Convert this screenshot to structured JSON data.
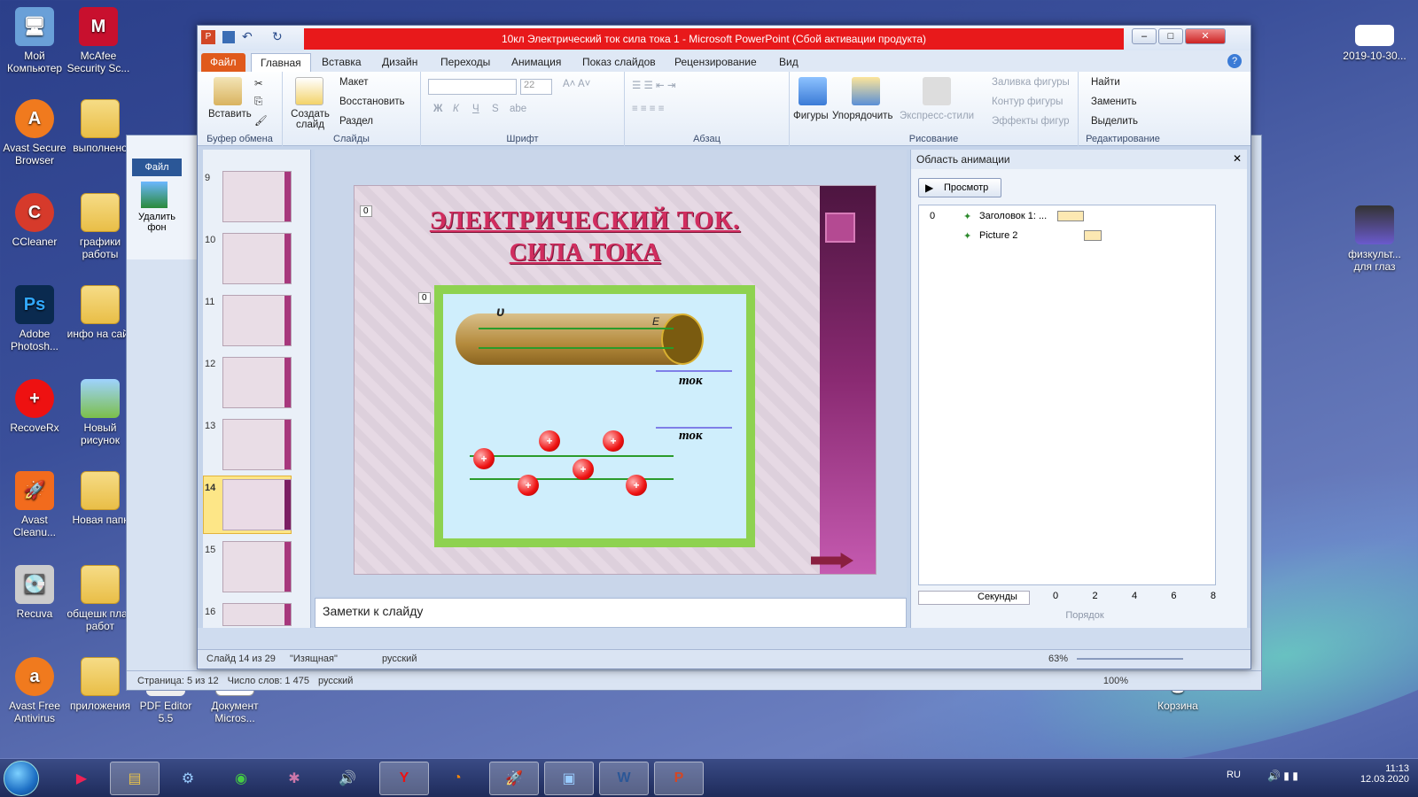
{
  "desktop": {
    "icons": [
      {
        "label": "Мой Компьютер"
      },
      {
        "label": "McAfee Security Sc..."
      },
      {
        "label": "Avast Secure Browser"
      },
      {
        "label": "выполнено"
      },
      {
        "label": "CCleaner"
      },
      {
        "label": "графики работы"
      },
      {
        "label": "Adobe Photosh..."
      },
      {
        "label": "инфо на сайт"
      },
      {
        "label": "RecoveRx"
      },
      {
        "label": "Новый рисунок"
      },
      {
        "label": "Avast Cleanu..."
      },
      {
        "label": "Новая папк"
      },
      {
        "label": "Recuva"
      },
      {
        "label": "общешк план работ"
      },
      {
        "label": "Avast Free Antivirus"
      },
      {
        "label": "приложения"
      },
      {
        "label": "PDF Editor 5.5"
      },
      {
        "label": "Документ Micros..."
      },
      {
        "label": "2019-10-30..."
      },
      {
        "label": "физкульт... для глаз"
      },
      {
        "label": "Корзина"
      }
    ]
  },
  "word": {
    "file_tab": "Файл",
    "remove_bg": "Удалить фон",
    "status": {
      "page": "Страница: 5 из 12",
      "words": "Число слов: 1 475",
      "lang": "русский",
      "zoom": "100%"
    }
  },
  "ppt": {
    "title": "10кл Электрический ток сила тока 1  -  Microsoft PowerPoint (Сбой активации продукта)",
    "tabs": [
      "Файл",
      "Главная",
      "Вставка",
      "Дизайн",
      "Переходы",
      "Анимация",
      "Показ слайдов",
      "Рецензирование",
      "Вид"
    ],
    "ribbon": {
      "clipboard": {
        "paste": "Вставить",
        "label": "Буфер обмена"
      },
      "slides": {
        "new_slide": "Создать слайд",
        "layout": "Макет",
        "reset": "Восстановить",
        "section": "Раздел",
        "label": "Слайды"
      },
      "font": {
        "size": "22",
        "label": "Шрифт",
        "bold": "Ж",
        "italic": "К",
        "underline": "Ч",
        "strike": "S",
        "shadow": "abe"
      },
      "paragraph": {
        "label": "Абзац"
      },
      "drawing": {
        "shapes": "Фигуры",
        "arrange": "Упорядочить",
        "quick_styles": "Экспресс-стили",
        "fill": "Заливка фигуры",
        "outline": "Контур фигуры",
        "effects": "Эффекты фигур",
        "label": "Рисование"
      },
      "editing": {
        "find": "Найти",
        "replace": "Заменить",
        "select": "Выделить",
        "label": "Редактирование"
      }
    },
    "slide_panel": {
      "thumbs": [
        {
          "num": "9"
        },
        {
          "num": "10"
        },
        {
          "num": "11"
        },
        {
          "num": "12"
        },
        {
          "num": "13"
        },
        {
          "num": "14"
        },
        {
          "num": "15"
        },
        {
          "num": "16"
        }
      ],
      "selected": "14"
    },
    "slide": {
      "title_line1": "ЭЛЕКТРИЧЕСКИЙ ТОК.",
      "title_line2": "СИЛА ТОКА",
      "anim_tag1": "0",
      "anim_tag2": "0",
      "label_tok1": "ток",
      "label_tok2": "ток",
      "label_v": "υ",
      "label_E": "E"
    },
    "notes_placeholder": "Заметки к слайду",
    "animation_pane": {
      "title": "Область анимации",
      "play": "Просмотр",
      "items": [
        {
          "index": "0",
          "name": "Заголовок 1: ..."
        },
        {
          "index": "",
          "name": "Picture 2"
        }
      ],
      "seconds": "Секунды",
      "timeline": [
        "0",
        "2",
        "4",
        "6",
        "8"
      ],
      "reorder": "Порядок"
    },
    "status": {
      "slide": "Слайд 14 из 29",
      "theme": "\"Изящная\"",
      "lang": "русский",
      "zoom": "63%"
    }
  },
  "taskbar": {
    "lang": "RU",
    "time": "11:13",
    "date": "12.03.2020"
  },
  "colors": {
    "title_red": "#e8191b",
    "file_tab": "#e05a1c",
    "accent_purple": "#a7377c"
  }
}
